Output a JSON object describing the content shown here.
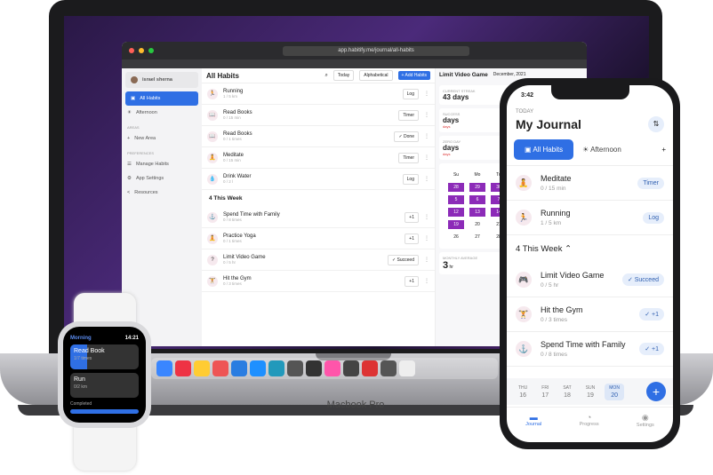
{
  "laptop": {
    "label": "Macbook Pro",
    "url": "app.habitify.me/journal/all-habits"
  },
  "sidebar": {
    "user": "israel sherna",
    "items": [
      {
        "label": "All Habits"
      },
      {
        "label": "Afternoon"
      }
    ],
    "areas_label": "AREAS",
    "new_area": "New Area",
    "prefs_label": "PREFERENCES",
    "prefs": [
      {
        "label": "Manage Habits"
      },
      {
        "label": "App Settings"
      },
      {
        "label": "Resources"
      }
    ]
  },
  "main": {
    "title": "All Habits",
    "today": "Today",
    "sort": "Alphabetical",
    "add": "+ Add Habits",
    "habits": [
      {
        "name": "Running",
        "sub": "1 / 5 km",
        "action": "Log",
        "icon": "🏃"
      },
      {
        "name": "Read Books",
        "sub": "0 / 15 min",
        "action": "Timer",
        "icon": "📖"
      },
      {
        "name": "Read Books",
        "sub": "0 / 1 times",
        "action": "✓ Done",
        "icon": "📖"
      },
      {
        "name": "Meditate",
        "sub": "0 / 15 min",
        "action": "Timer",
        "icon": "🧘"
      },
      {
        "name": "Drink Water",
        "sub": "0 / 2 l",
        "action": "Log",
        "icon": "💧"
      }
    ],
    "week_label": "4 This Week",
    "week": [
      {
        "name": "Spend Time with Family",
        "sub": "0 / 8 times",
        "action": "+1",
        "icon": "⚓"
      },
      {
        "name": "Practice Yoga",
        "sub": "0 / 1 times",
        "action": "+1",
        "icon": "🧘"
      },
      {
        "name": "Limit Video Game",
        "sub": "0 / 5 hr",
        "action": "✓ Succeed",
        "icon": "?"
      },
      {
        "name": "Hit the Gym",
        "sub": "0 / 3 times",
        "action": "+1",
        "icon": "🏋"
      }
    ]
  },
  "detail": {
    "title": "Limit Video Game",
    "month": "December, 2021",
    "streak_label": "CURRENT STREAK",
    "streak": "43 days",
    "success_label": "SUCCESS",
    "success": "days",
    "success_sub": "days",
    "zero_label": "ZERO DAY",
    "zero": "days",
    "zero_sub": "days",
    "cal_head": [
      "Su",
      "Mo",
      "Tu"
    ],
    "cal": [
      "28",
      "29",
      "30",
      "5",
      "6",
      "7",
      "12",
      "13",
      "14",
      "19",
      "20",
      "21",
      "26",
      "27",
      "28"
    ],
    "cal_marked": [
      0,
      1,
      2,
      3,
      4,
      5,
      6,
      7,
      8,
      9
    ],
    "avg_label": "MONTHLY AVERAGE",
    "avg": "3",
    "avg_unit": "hr"
  },
  "watch": {
    "title": "Morning",
    "time": "14:21",
    "cards": [
      {
        "name": "Read Book",
        "sub": "1/7 times",
        "progress": 0.25
      },
      {
        "name": "Run",
        "sub": "0/2 km",
        "progress": 0
      }
    ],
    "completed": "Completed"
  },
  "phone": {
    "time": "3:42",
    "today": "TODAY",
    "title": "My Journal",
    "tab_all": "All Habits",
    "tab_afternoon": "Afternoon",
    "habits": [
      {
        "name": "Meditate",
        "sub": "0 / 15 min",
        "action": "Timer",
        "icon": "🧘"
      },
      {
        "name": "Running",
        "sub": "1 / 5 km",
        "action": "Log",
        "icon": "🏃"
      }
    ],
    "week_label": "4 This Week",
    "week": [
      {
        "name": "Limit Video Game",
        "sub": "0 / 5 hr",
        "action": "✓ Succeed",
        "icon": "🎮"
      },
      {
        "name": "Hit the Gym",
        "sub": "0 / 3 times",
        "action": "✓ +1",
        "icon": "🏋"
      },
      {
        "name": "Spend Time with Family",
        "sub": "0 / 8 times",
        "action": "✓ +1",
        "icon": "⚓"
      }
    ],
    "days": [
      {
        "d": "THU",
        "n": "16"
      },
      {
        "d": "FRI",
        "n": "17"
      },
      {
        "d": "SAT",
        "n": "18"
      },
      {
        "d": "SUN",
        "n": "19"
      },
      {
        "d": "MON",
        "n": "20"
      }
    ],
    "nav": [
      "Journal",
      "Progress",
      "Settings"
    ]
  },
  "colors": {
    "accent": "#2f6fe4",
    "purple": "#8c2bb8"
  }
}
